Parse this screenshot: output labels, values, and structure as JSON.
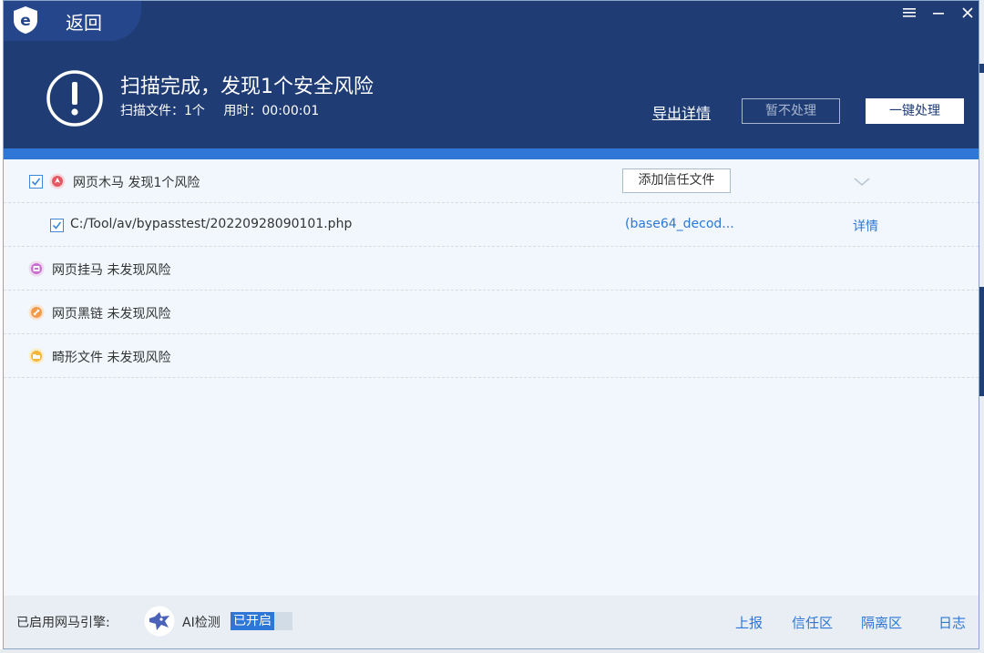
{
  "header": {
    "back_label": "返回",
    "window_controls": [
      "menu-icon",
      "minimize-icon",
      "close-icon"
    ],
    "title": "扫描完成，发现1个安全风险",
    "scanned_files": "扫描文件：1个",
    "elapsed": "用时：00:00:01",
    "export_label": "导出详情",
    "ignore_label": "暂不处理",
    "fix_all_label": "一键处理"
  },
  "categories": [
    {
      "name": "网页木马 发现1个风险",
      "icon": "trojan-icon",
      "checked": true,
      "trust_button": "添加信任文件",
      "files": [
        {
          "path": "C:/Tool/av/bypasstest/20220928090101.php",
          "detail": "(base64_decod...",
          "detail_link": "详情",
          "checked": true
        }
      ]
    },
    {
      "name": "网页挂马 未发现风险",
      "icon": "webpage-hang-icon"
    },
    {
      "name": "网页黑链 未发现风险",
      "icon": "black-link-icon"
    },
    {
      "name": "畸形文件 未发现风险",
      "icon": "malformed-file-icon"
    }
  ],
  "footer": {
    "engine_label": "已启用网马引擎:",
    "ai_label": "AI检测",
    "ai_status": "已开启",
    "links": [
      "上报",
      "信任区",
      "隔离区",
      "日志"
    ]
  },
  "colors": {
    "header_bg": "#1f3c75",
    "accent_blue": "#2e77d6",
    "body_bg": "#f1f7fc",
    "footer_bg": "#e8eef4"
  }
}
